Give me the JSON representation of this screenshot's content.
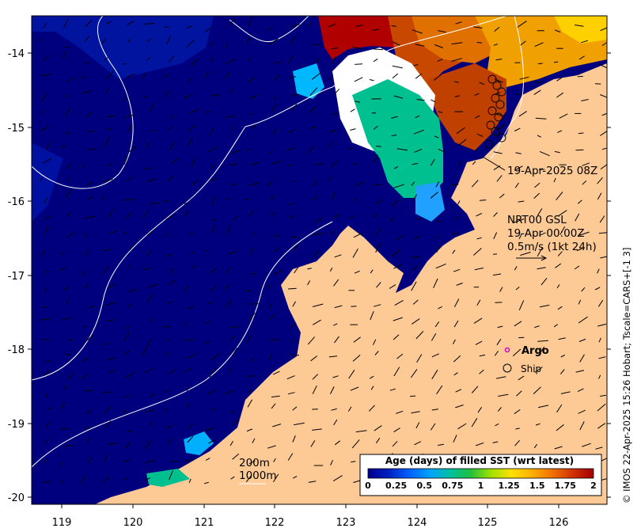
{
  "x_ticks": [
    "119",
    "120",
    "121",
    "122",
    "123",
    "124",
    "125",
    "126"
  ],
  "y_ticks": [
    "-14",
    "-15",
    "-16",
    "-17",
    "-18",
    "-19",
    "-20"
  ],
  "annotations": {
    "track_time": "19-Apr-2025 08Z",
    "current_source": "NRT00 GSL",
    "current_time": "19-Apr 00:00Z",
    "current_scale": "0.5m/s (1kt 24h)",
    "argo_label": "Argo",
    "ship_label": "Ship",
    "depth_200": "200m",
    "depth_1000": "1000m"
  },
  "legend": {
    "title": "Age (days) of filled SST (wrt latest)",
    "ticks": [
      "0",
      "0.25",
      "0.5",
      "0.75",
      "1",
      "1.25",
      "1.5",
      "1.75",
      "2"
    ],
    "colors": [
      "#00008f",
      "#0020c0",
      "#0060ff",
      "#00a0ff",
      "#00c0a0",
      "#20c040",
      "#a0e000",
      "#ffe000",
      "#ffb000",
      "#f07000",
      "#d03000",
      "#a00000"
    ]
  },
  "credit": "© IMOS 22-Apr-2025 15:26 Hobart; Tscale=CARS+[-1 3]",
  "colors": {
    "land": "#fdca96",
    "ocean_deep": "#00007f",
    "ocean_mid": "#0016a0",
    "argo": "#d000d0"
  },
  "icons": [
    "current-arrow-icon",
    "argo-marker-icon",
    "ship-marker-icon"
  ]
}
